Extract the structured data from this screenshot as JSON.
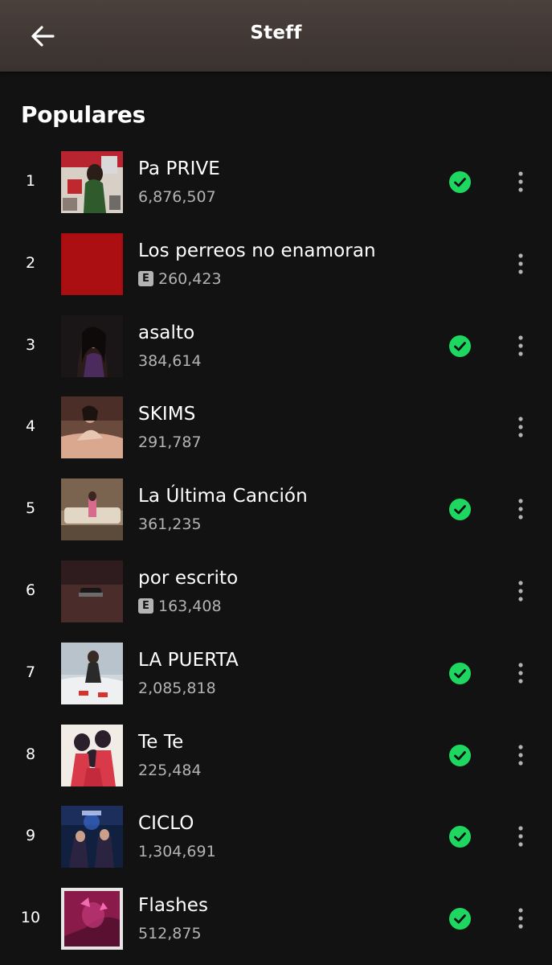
{
  "header": {
    "title": "Steff",
    "back_icon": "arrow-left-icon"
  },
  "section": {
    "title": "Populares"
  },
  "colors": {
    "accent_green": "#1ed760",
    "background": "#121212",
    "header": "#3f3633",
    "secondary_text": "#b3b3b3"
  },
  "tracks": [
    {
      "rank": "1",
      "title": "Pa PRIVE",
      "plays": "6,876,507",
      "explicit": false,
      "saved": true
    },
    {
      "rank": "2",
      "title": "Los perreos no enamoran",
      "plays": "260,423",
      "explicit": true,
      "saved": false
    },
    {
      "rank": "3",
      "title": "asalto",
      "plays": "384,614",
      "explicit": false,
      "saved": true
    },
    {
      "rank": "4",
      "title": "SKIMS",
      "plays": "291,787",
      "explicit": false,
      "saved": false
    },
    {
      "rank": "5",
      "title": "La Última Canción",
      "plays": "361,235",
      "explicit": false,
      "saved": true
    },
    {
      "rank": "6",
      "title": "por escrito",
      "plays": "163,408",
      "explicit": true,
      "saved": false
    },
    {
      "rank": "7",
      "title": "LA PUERTA",
      "plays": "2,085,818",
      "explicit": false,
      "saved": true
    },
    {
      "rank": "8",
      "title": "Te Te",
      "plays": "225,484",
      "explicit": false,
      "saved": true
    },
    {
      "rank": "9",
      "title": "CICLO",
      "plays": "1,304,691",
      "explicit": false,
      "saved": true
    },
    {
      "rank": "10",
      "title": "Flashes",
      "plays": "512,875",
      "explicit": false,
      "saved": true
    }
  ],
  "explicit_label": "E",
  "icons": {
    "saved": "check-circle-icon",
    "more": "more-vertical-icon"
  }
}
